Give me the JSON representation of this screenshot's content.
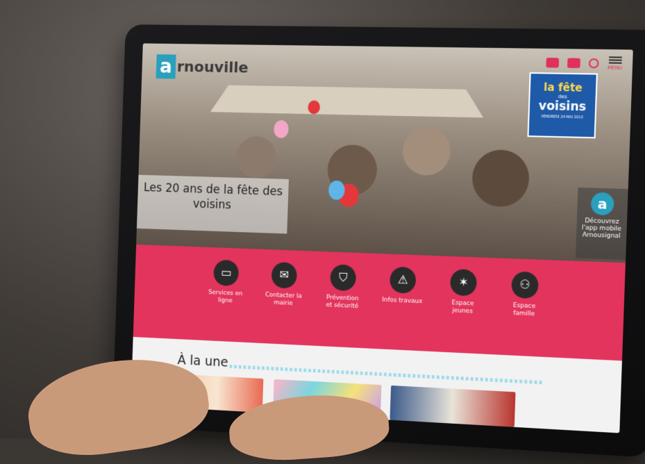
{
  "site": {
    "logo_mark": "a",
    "logo_text": "rnouville",
    "menu_label": "MENU"
  },
  "poster": {
    "line1": "la fête",
    "line2": "des",
    "line3": "voisins",
    "line4": "VENDREDI 24 MAI 2013"
  },
  "hero": {
    "caption": "Les 20 ans de la fête des voisins"
  },
  "app_promo": {
    "icon_letter": "a",
    "text": "Découvrez l'app mobile Arnousignal"
  },
  "services": [
    {
      "label": "Services en ligne",
      "icon": "laptop-icon",
      "glyph": "▭"
    },
    {
      "label": "Contacter la mairie",
      "icon": "mail-icon",
      "glyph": "✉"
    },
    {
      "label": "Prévention et sécurité",
      "icon": "shield-icon",
      "glyph": "⛉"
    },
    {
      "label": "Infos travaux",
      "icon": "warning-icon",
      "glyph": "⚠"
    },
    {
      "label": "Espace jeunes",
      "icon": "jumping-person-icon",
      "glyph": "✶"
    },
    {
      "label": "Espace famille",
      "icon": "family-icon",
      "glyph": "⚇"
    }
  ],
  "news": {
    "title": "À la une"
  },
  "colors": {
    "accent": "#e3345d",
    "brand_blue": "#2b9fbe",
    "icon_dark": "#2a2a2a"
  }
}
